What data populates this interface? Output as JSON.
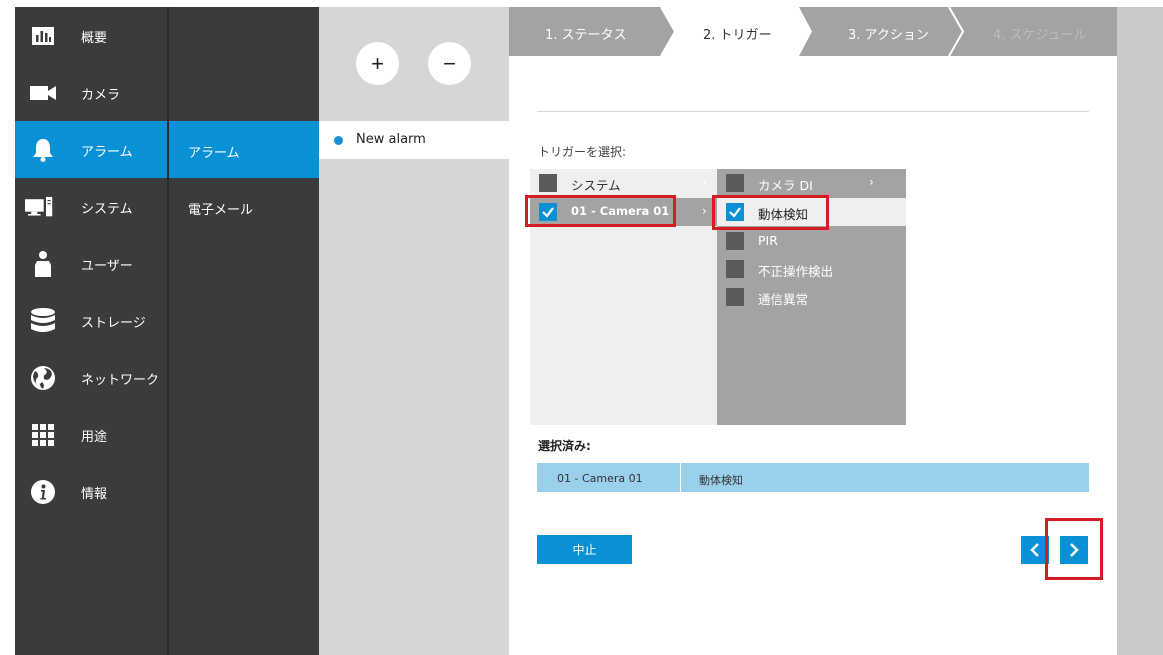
{
  "sidebar": {
    "items": [
      {
        "label": "概要",
        "icon": "overview-chart-icon"
      },
      {
        "label": "カメラ",
        "icon": "camera-icon"
      },
      {
        "label": "アラーム",
        "icon": "bell-icon",
        "active": true
      },
      {
        "label": "システム",
        "icon": "system-monitor-icon"
      },
      {
        "label": "ユーザー",
        "icon": "user-icon"
      },
      {
        "label": "ストレージ",
        "icon": "database-icon"
      },
      {
        "label": "ネットワーク",
        "icon": "globe-icon"
      },
      {
        "label": "用途",
        "icon": "grid-icon"
      },
      {
        "label": "情報",
        "icon": "info-icon"
      }
    ]
  },
  "submenu": {
    "items": [
      {
        "label": "アラーム",
        "active": true
      },
      {
        "label": "電子メール"
      }
    ]
  },
  "alarm_list": {
    "add_symbol": "+",
    "remove_symbol": "−",
    "items": [
      {
        "label": "New alarm"
      }
    ]
  },
  "wizard": {
    "steps": [
      {
        "label": "1. ステータス"
      },
      {
        "label": "2. トリガー",
        "active": true
      },
      {
        "label": "3. アクション"
      },
      {
        "label": "4. スケジュール",
        "disabled": true
      }
    ],
    "trigger_title": "トリガーを選択:",
    "sources": [
      {
        "label": "システム",
        "checked": false
      },
      {
        "label": "01 - Camera 01",
        "checked": true,
        "selected": true
      }
    ],
    "events": [
      {
        "label": "カメラ DI",
        "checked": false,
        "has_children": true
      },
      {
        "label": "動体検知",
        "checked": true,
        "selected": true
      },
      {
        "label": "PIR",
        "checked": false
      },
      {
        "label": "不正操作検出",
        "checked": false
      },
      {
        "label": "通信異常",
        "checked": false
      }
    ],
    "selected_title": "選択済み:",
    "selected": {
      "source": "01 - Camera 01",
      "event": "動体検知"
    },
    "cancel_label": "中止"
  },
  "colors": {
    "accent": "#0a90d4",
    "sidebar": "#3b3b3b",
    "highlight": "#d51b24",
    "selected_row": "#9bd0ec"
  }
}
